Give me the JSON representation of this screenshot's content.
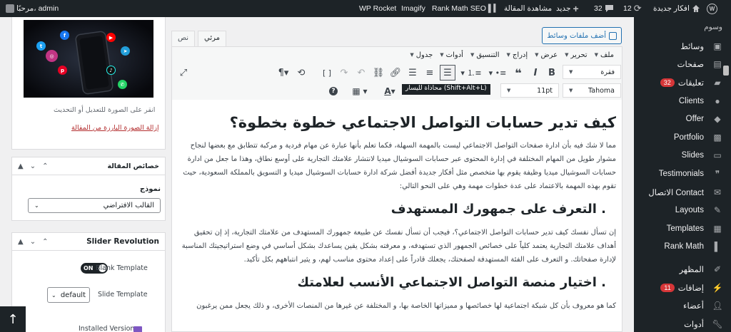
{
  "adminbar": {
    "greeting": "مرحبًا، admin",
    "wp_rocket": "WP Rocket",
    "imagify": "Imagify",
    "rankmath": "Rank Math SEO",
    "view_post": "مشاهدة المقالة",
    "new": "جديد",
    "comments_count": "32",
    "updates_count": "12",
    "site_name": "افكار جديدة"
  },
  "sidebar": {
    "top_label": "وسوم",
    "items": [
      {
        "label": "وسائط",
        "icon": "media-icon"
      },
      {
        "label": "صفحات",
        "icon": "pages-icon"
      },
      {
        "label": "تعليقات",
        "icon": "comments-icon",
        "badge": "32"
      },
      {
        "label": "Clients",
        "icon": "clients-icon"
      },
      {
        "label": "Offer",
        "icon": "offer-icon"
      },
      {
        "label": "Portfolio",
        "icon": "portfolio-icon"
      },
      {
        "label": "Slides",
        "icon": "slides-icon"
      },
      {
        "label": "Testimonials",
        "icon": "testimonials-icon"
      },
      {
        "label": "الاتصال Contact",
        "icon": "contact-icon"
      },
      {
        "label": "Layouts",
        "icon": "layouts-icon"
      },
      {
        "label": "Templates",
        "icon": "templates-icon"
      },
      {
        "label": "Rank Math",
        "icon": "rankmath-icon"
      },
      {
        "label": "المظهر",
        "icon": "appearance-icon"
      },
      {
        "label": "إضافات",
        "icon": "plugins-icon",
        "badge": "11"
      },
      {
        "label": "أعضاء",
        "icon": "users-icon"
      },
      {
        "label": "أدوات",
        "icon": "tools-icon"
      }
    ]
  },
  "editor": {
    "tab_visual": "مرئي",
    "tab_text": "نص",
    "add_media": "أضف ملفات وسائط",
    "menus": [
      "ملف",
      "تحرير",
      "عرض",
      "إدراج",
      "التنسيق",
      "أدوات",
      "جدول"
    ],
    "format_select": "فقرة",
    "font_family": "Tahoma",
    "font_size": "11pt",
    "tooltip": "محاذاة لليسار (Shift+Alt+L)"
  },
  "content": {
    "h1": "كيف تدير حسابات التواصل الاجتماعي خطوة بخطوة؟",
    "p1": "مما لا شك فيه بأن ادارة صفحات التواصل الاجتماعي ليست بالمهمة السهلة، فكما تعلم بأنها عبارة عن مهام فردية و مركبة تتطابق مع بعضها لنجاح مشوار طويل من المهام المختلفة في إدارة المحتوى عبر حسابات السوشيال ميديا لانتشار علامتك التجارية على أوسع نطاق، وهذا ما جعل من ادارة حسابات السوشيال ميديا وظيفة يقوم بها متخصص مثل أفكار جديدة أفضل شركة ادارة حسابات السوشيال ميديا و التسويق بالمملكة السعودية، حيث تقوم بهذه المهمة بالاعتماد على عدة خطوات مهمة وهي على النحو التالي:",
    "h2a": ". التعرف على جمهورك المستهدف",
    "p2": "إن تسأل نفسك كيف تدير حسابات التواصل الاجتماعي؟، فيجب أن تسأل نفسك عن طبيعة جمهورك المستهدف من علامتك التجارية، إذ إن تحقيق أهداف علامتك التجارية يعتمد كلياً على خصائص الجمهور الذي تستهدفه، و معرفته بشكل يقين يساعدك بشكل أساسي في وضع استراتيجيتك المناسبة لإدارة صفحاتك. و التعرف على الفئة المستهدفة لصفحتك، يجعلك قادراً على إعداد محتوى مناسب لهم، و يثير انتباههم بكل تأكيد.",
    "h2b": ". اختيار منصة التواصل الاجتماعي الأنسب لعلامتك",
    "p3": "كما هو معروف بأن كل شبكة اجتماعية لها خصائصها و مميزاتها الخاصة بها، و المختلفة عن غيرها من المنصات الأخرى، و ذلك يجعل ممن يرغبون"
  },
  "featured": {
    "click_hint": "انقر على الصورة للتعديل أو التحديث",
    "remove_link": "إزالة الصورة البارزة من المقالة"
  },
  "attributes": {
    "title": "خصائص المقالة",
    "template_label": "نموذج",
    "template_value": "القالب الافتراضي"
  },
  "slider": {
    "title": "Slider Revolution",
    "blank_template": "Blank Template",
    "toggle_on": "ON",
    "slide_template": "Slide Template",
    "slide_template_value": "default",
    "installed_version": "Installed Version"
  },
  "colors": {
    "admin_dark": "#1d2327",
    "accent": "#2271b1",
    "badge": "#d63638",
    "link_red": "#b32d2e"
  }
}
